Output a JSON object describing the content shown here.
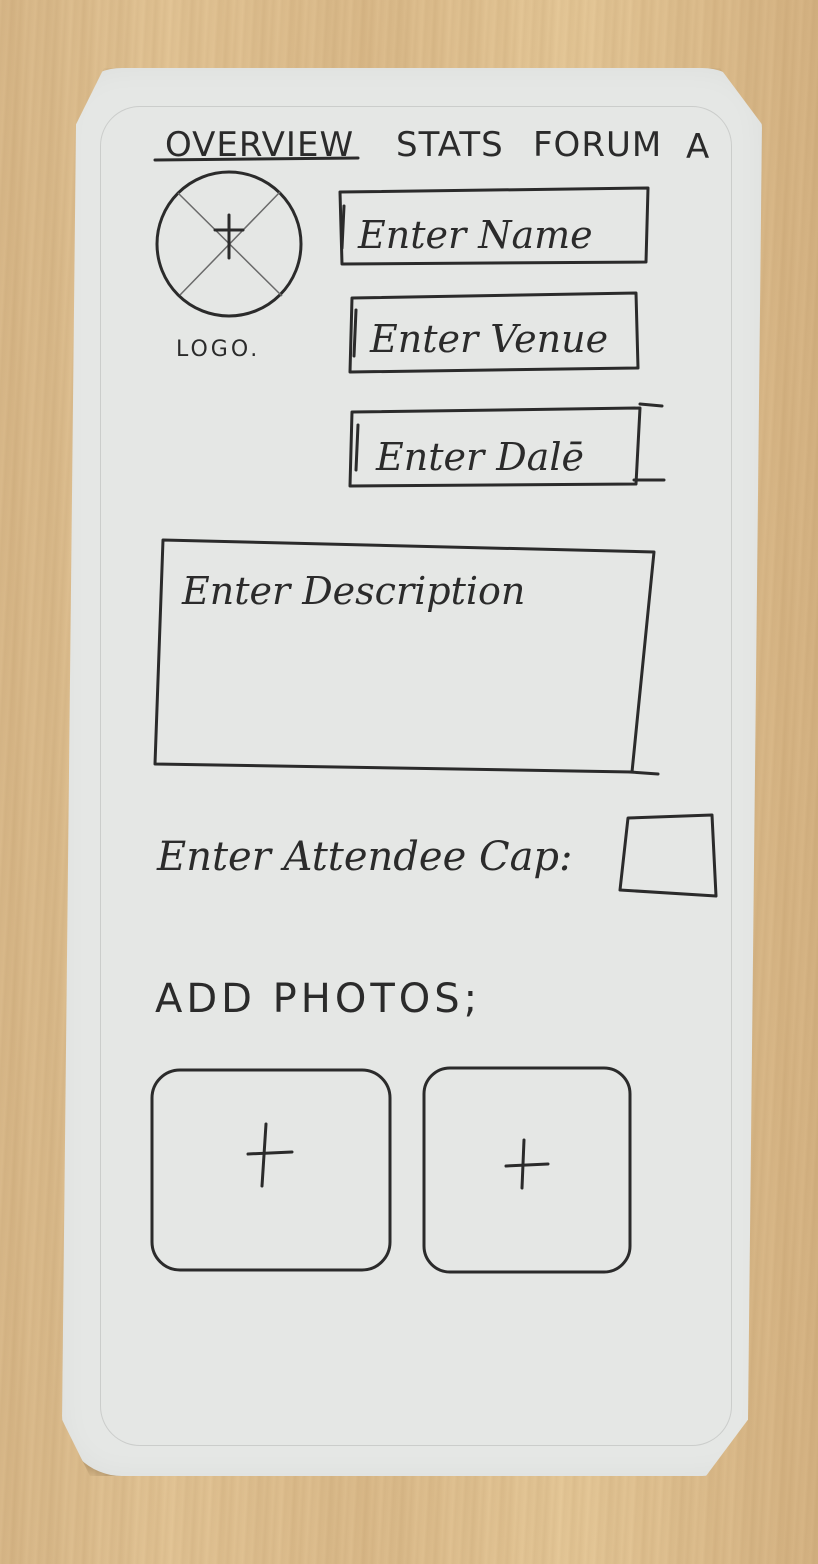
{
  "nav": {
    "tabs": [
      {
        "label": "OVERVIEW",
        "active": true
      },
      {
        "label": "STATS",
        "active": false
      },
      {
        "label": "FORUM",
        "active": false
      },
      {
        "label": "A",
        "active": false
      }
    ]
  },
  "logo": {
    "caption": "LOGO.",
    "icon": "image-placeholder-icon"
  },
  "fields": {
    "name_placeholder": "Enter Name",
    "venue_placeholder": "Enter Venue",
    "date_placeholder": "Enter Dalē",
    "description_placeholder": "Enter Description"
  },
  "attendee": {
    "label": "Enter Attendee Cap:"
  },
  "photos": {
    "heading": "ADD PHOTOS;",
    "slots": [
      {
        "icon": "plus-icon"
      },
      {
        "icon": "plus-icon"
      }
    ]
  },
  "colors": {
    "ink": "#2b2b2b",
    "paper": "#e5e7e5",
    "wood": "#dcbc8c"
  }
}
